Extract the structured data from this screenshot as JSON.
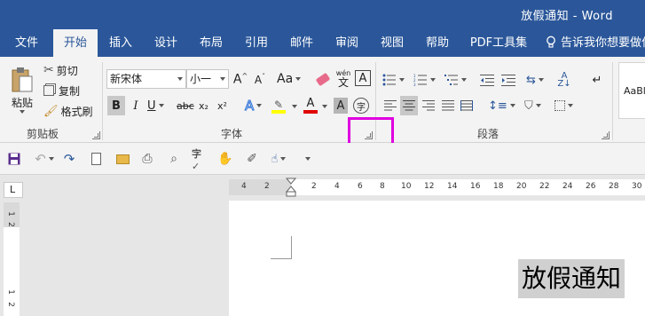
{
  "window": {
    "title": "放假通知  -  Word"
  },
  "tabs": [
    "文件",
    "开始",
    "插入",
    "设计",
    "布局",
    "引用",
    "邮件",
    "审阅",
    "视图",
    "帮助",
    "PDF工具集"
  ],
  "active_tab": "开始",
  "tell_me": "告诉我你想要做什",
  "clipboard": {
    "paste": "粘贴",
    "cut": "剪切",
    "copy": "复制",
    "format_painter": "格式刷",
    "group_label": "剪贴板"
  },
  "font": {
    "font_name": "新宋体",
    "font_size": "小一",
    "aa_label": "Aa",
    "wen_label": "wén",
    "wen_char": "文",
    "a_box": "A",
    "bold": "B",
    "italic": "I",
    "underline": "U",
    "strike": "abc",
    "subscript": "x₂",
    "superscript": "x²",
    "char_circle": "字",
    "group_label": "字体"
  },
  "paragraph": {
    "group_label": "段落"
  },
  "styles": {
    "preview": "AaBl"
  },
  "ruler": {
    "ticks": [
      "4",
      "2",
      "2",
      "4",
      "6",
      "8",
      "10",
      "12",
      "14",
      "16",
      "18",
      "20",
      "22",
      "24",
      "26",
      "28",
      "30"
    ],
    "vticks": [
      "1",
      "2",
      "1",
      "2"
    ],
    "corner": "L"
  },
  "document": {
    "heading": "放假通知"
  },
  "colors": {
    "brand": "#2b579a",
    "highlight_box": "#e000e0",
    "font_color": "#e00000",
    "highlight_color": "#ffff00"
  }
}
